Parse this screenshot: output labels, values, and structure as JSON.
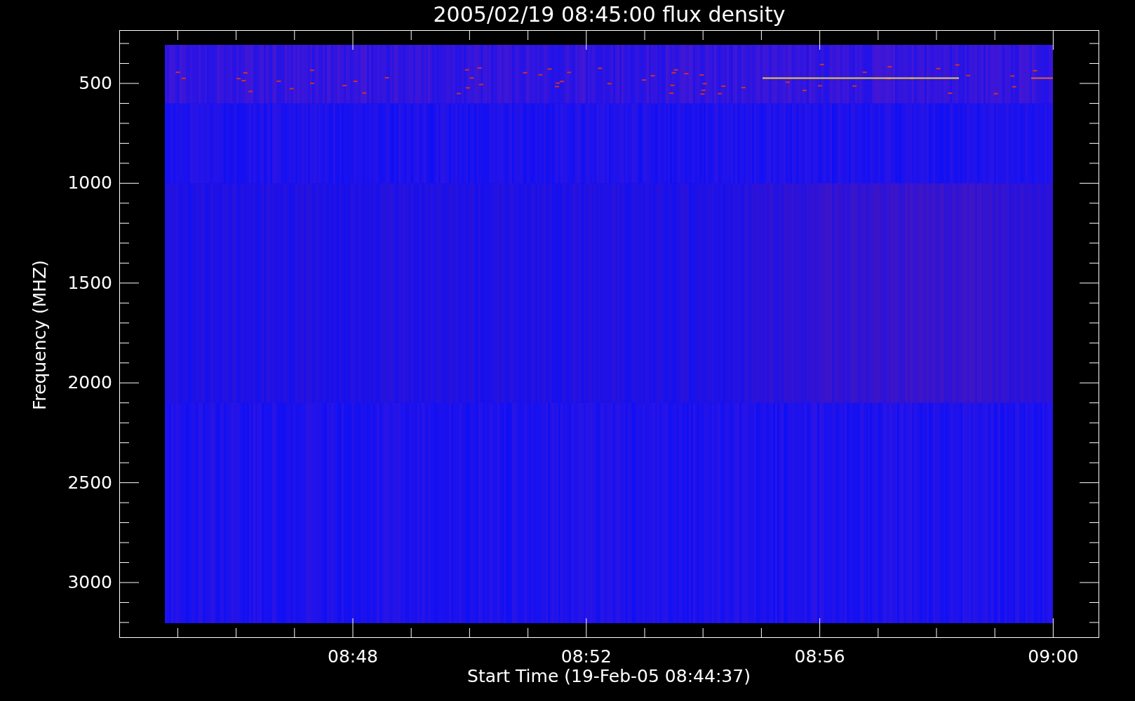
{
  "plot": {
    "title": "2005/02/19 08:45:00 flux density",
    "ylabel": "Frequency (MHZ)",
    "xlabel": "Start Time (19-Feb-05 08:44:37)",
    "yticks": [
      "500",
      "1000",
      "1500",
      "2000",
      "2500",
      "3000"
    ],
    "xticks": [
      "08:48",
      "08:52",
      "08:56",
      "09:00"
    ]
  }
}
